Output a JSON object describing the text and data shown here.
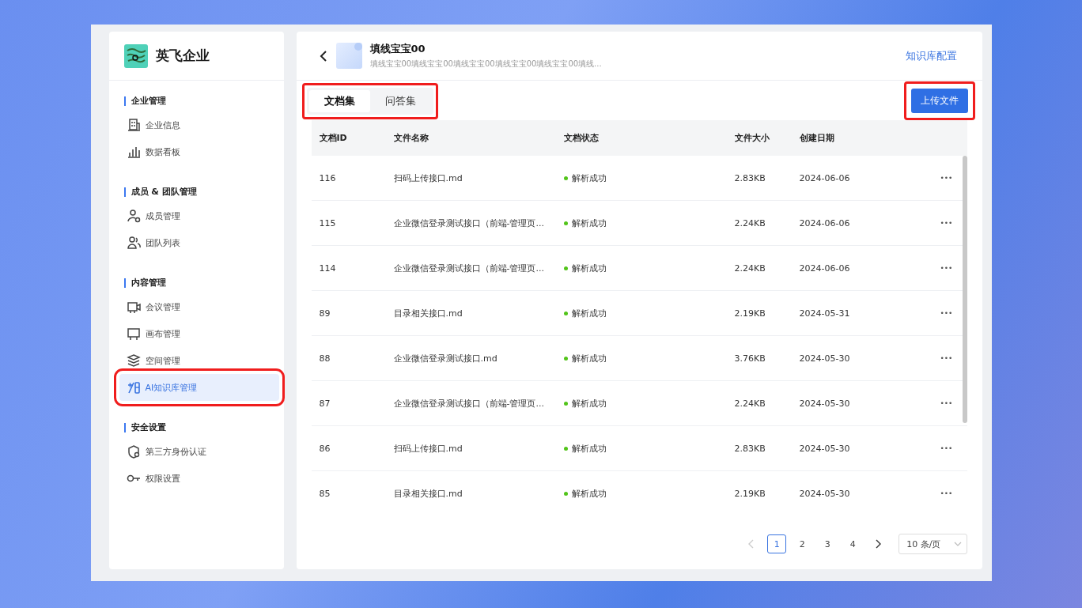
{
  "sidebar": {
    "brand": "英飞企业",
    "groups": [
      {
        "title": "企业管理",
        "items": [
          {
            "label": "企业信息",
            "selected": false,
            "annotated": false
          },
          {
            "label": "数据看板",
            "selected": false,
            "annotated": false
          }
        ]
      },
      {
        "title": "成员 & 团队管理",
        "items": [
          {
            "label": "成员管理",
            "selected": false,
            "annotated": false
          },
          {
            "label": "团队列表",
            "selected": false,
            "annotated": false
          }
        ]
      },
      {
        "title": "内容管理",
        "items": [
          {
            "label": "会议管理",
            "selected": false,
            "annotated": false
          },
          {
            "label": "画布管理",
            "selected": false,
            "annotated": false
          },
          {
            "label": "空间管理",
            "selected": false,
            "annotated": false
          },
          {
            "label": "AI知识库管理",
            "selected": true,
            "annotated": true
          }
        ]
      },
      {
        "title": "安全设置",
        "items": [
          {
            "label": "第三方身份认证",
            "selected": false,
            "annotated": false
          },
          {
            "label": "权限设置",
            "selected": false,
            "annotated": false
          }
        ]
      }
    ]
  },
  "header": {
    "title": "填线宝宝00",
    "subtitle": "填线宝宝00填线宝宝00填线宝宝00填线宝宝00填线宝宝00填线...",
    "config_link": "知识库配置"
  },
  "tabs": {
    "annotated": true,
    "items": [
      {
        "label": "文档集",
        "selected": true
      },
      {
        "label": "问答集",
        "selected": false
      }
    ]
  },
  "upload_button": {
    "label": "上传文件",
    "annotated": true
  },
  "table": {
    "columns": [
      "文档ID",
      "文件名称",
      "文档状态",
      "文件大小",
      "创建日期"
    ],
    "rows": [
      {
        "id": "116",
        "name": "扫码上传接口.md",
        "status": "解析成功",
        "size": "2.83KB",
        "date": "2024-06-06",
        "more": "•••"
      },
      {
        "id": "115",
        "name": "企业微信登录测试接口（前端-管理页...",
        "status": "解析成功",
        "size": "2.24KB",
        "date": "2024-06-06",
        "more": "•••"
      },
      {
        "id": "114",
        "name": "企业微信登录测试接口（前端-管理页...",
        "status": "解析成功",
        "size": "2.24KB",
        "date": "2024-06-06",
        "more": "•••"
      },
      {
        "id": "89",
        "name": "目录相关接口.md",
        "status": "解析成功",
        "size": "2.19KB",
        "date": "2024-05-31",
        "more": "•••"
      },
      {
        "id": "88",
        "name": "企业微信登录测试接口.md",
        "status": "解析成功",
        "size": "3.76KB",
        "date": "2024-05-30",
        "more": "•••"
      },
      {
        "id": "87",
        "name": "企业微信登录测试接口（前端-管理页...",
        "status": "解析成功",
        "size": "2.24KB",
        "date": "2024-05-30",
        "more": "•••"
      },
      {
        "id": "86",
        "name": "扫码上传接口.md",
        "status": "解析成功",
        "size": "2.83KB",
        "date": "2024-05-30",
        "more": "•••"
      },
      {
        "id": "85",
        "name": "目录相关接口.md",
        "status": "解析成功",
        "size": "2.19KB",
        "date": "2024-05-30",
        "more": "•••"
      }
    ]
  },
  "pagination": {
    "pages": [
      {
        "label": "1",
        "selected": true
      },
      {
        "label": "2",
        "selected": false
      },
      {
        "label": "3",
        "selected": false
      },
      {
        "label": "4",
        "selected": false
      }
    ],
    "prev_disabled": true,
    "next_disabled": false,
    "page_size": "10 条/页"
  }
}
